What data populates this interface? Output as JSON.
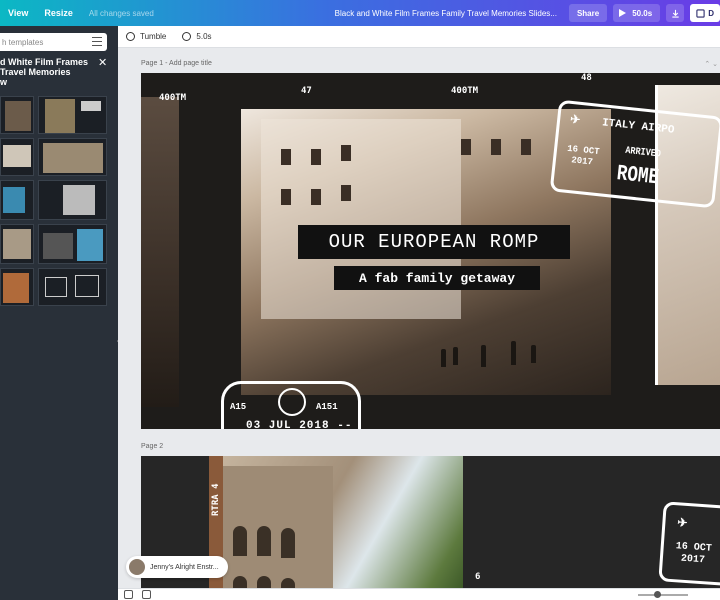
{
  "topbar": {
    "menu_view": "View",
    "menu_resize": "Resize",
    "save_status": "All changes saved",
    "doc_title": "Black and White Film Frames Family Travel Memories Slides...",
    "share_label": "Share",
    "play_duration": "50.0s",
    "download_label": "D"
  },
  "sidebar": {
    "search_placeholder": "h templates",
    "template_title_line1": "d White Film Frames",
    "template_title_line2": "Travel Memories",
    "template_title_line3": "w"
  },
  "toolbar": {
    "animation_label": "Tumble",
    "duration_label": "5.0s"
  },
  "pages": {
    "page1_label": "Page 1 - Add page title",
    "page2_label": "Page 2"
  },
  "slide1": {
    "heading": "OUR EUROPEAN ROMP",
    "subheading": "A fab family getaway",
    "film_numbers": [
      "400TM",
      "47",
      "400TM",
      "48"
    ],
    "stamp_airport": "ITALY AIRPO",
    "stamp_status": "ARRIVED",
    "stamp_date_day": "16 OCT",
    "stamp_date_year": "2017",
    "stamp_city": "ROME",
    "stamp2_code_left": "A15",
    "stamp2_code_right": "A151",
    "stamp2_date": "03 JUL 2018 ---"
  },
  "slide2": {
    "side_text": "RTRA 4",
    "stamp_date_day": "16 OCT",
    "stamp_date_year": "2017",
    "frame_number": "6"
  },
  "footer": {
    "author": "Jenny's Alright Enstr..."
  }
}
